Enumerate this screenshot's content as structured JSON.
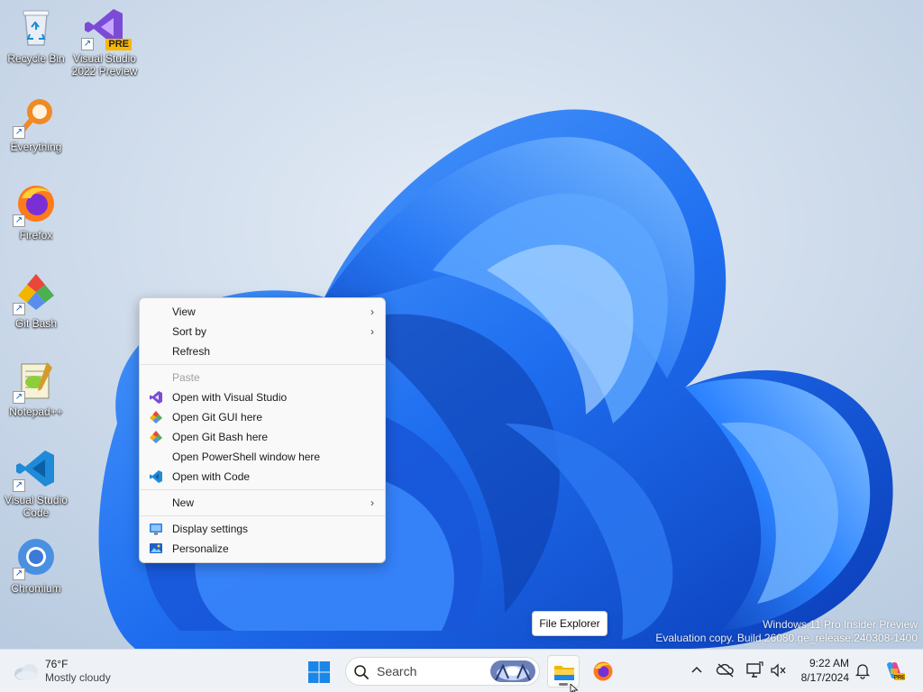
{
  "desktop": {
    "icons": [
      {
        "label": "Recycle Bin",
        "icon": "recycle-bin-icon"
      },
      {
        "label": "Visual Studio\n2022 Preview",
        "icon": "visual-studio-preview-icon",
        "badge": "PRE"
      },
      {
        "label": "Everything",
        "icon": "everything-search-icon"
      },
      {
        "label": "Firefox",
        "icon": "firefox-icon"
      },
      {
        "label": "Git Bash",
        "icon": "git-bash-icon"
      },
      {
        "label": "Notepad++",
        "icon": "notepad-plus-plus-icon"
      },
      {
        "label": "Visual Studio\nCode",
        "icon": "vscode-icon"
      },
      {
        "label": "Chromium",
        "icon": "chromium-icon"
      }
    ]
  },
  "context_menu": {
    "items": [
      {
        "label": "View",
        "submenu": true
      },
      {
        "label": "Sort by",
        "submenu": true
      },
      {
        "label": "Refresh"
      },
      {
        "label": "Paste",
        "disabled": true
      },
      {
        "label": "Open with Visual Studio",
        "icon": "visual-studio-icon"
      },
      {
        "label": "Open Git GUI here",
        "icon": "git-icon"
      },
      {
        "label": "Open Git Bash here",
        "icon": "git-icon"
      },
      {
        "label": "Open PowerShell window here"
      },
      {
        "label": "Open with Code",
        "icon": "vscode-icon"
      },
      {
        "label": "New",
        "submenu": true
      },
      {
        "label": "Display settings",
        "icon": "display-icon"
      },
      {
        "label": "Personalize",
        "icon": "personalize-icon"
      }
    ],
    "submenu_glyph": "›"
  },
  "tooltip": {
    "text": "File Explorer"
  },
  "watermark": {
    "line1": "Windows 11 Pro Insider Preview",
    "line2": "Evaluation copy. Build 26080.ge_release.240308-1400"
  },
  "taskbar": {
    "weather": {
      "temp": "76°F",
      "condition": "Mostly cloudy"
    },
    "search": {
      "placeholder": "Search"
    },
    "apps": [
      {
        "name": "File Explorer",
        "icon": "file-explorer-icon",
        "running": true
      },
      {
        "name": "Firefox",
        "icon": "firefox-icon"
      }
    ],
    "tray_icons": [
      "chevron-up-icon",
      "onedrive-offline-icon",
      "network-icon",
      "volume-icon",
      "notification-bell-icon",
      "copilot-icon"
    ],
    "clock": {
      "time": "9:22 AM",
      "date": "8/17/2024"
    }
  },
  "colors": {
    "accent": "#0067c0",
    "wallpaper_bloom": "#1a6cf0",
    "taskbar_bg": "#eef2f7"
  }
}
